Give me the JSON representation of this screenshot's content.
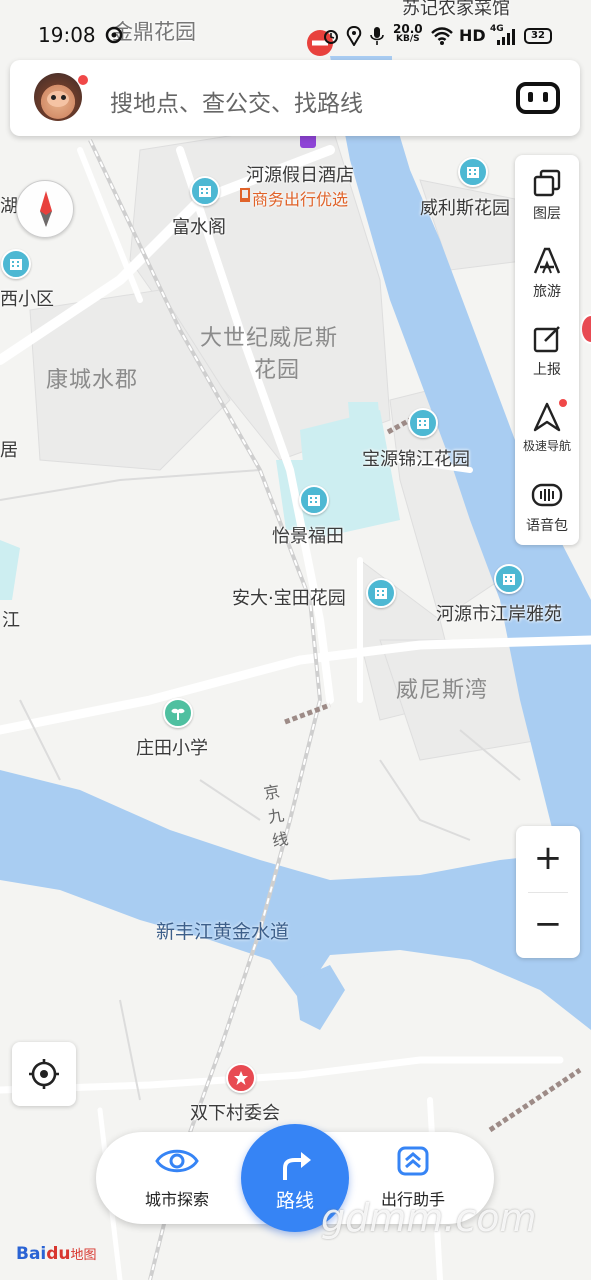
{
  "status_bar": {
    "time": "19:08",
    "net_speed_value": "20.0",
    "net_speed_unit": "KB/S",
    "hd": "HD",
    "signal": "4G",
    "battery": "32"
  },
  "search": {
    "placeholder": "搜地点、查公交、找路线"
  },
  "toolbar": {
    "items": [
      {
        "label": "图层",
        "icon": "layers-icon"
      },
      {
        "label": "旅游",
        "icon": "travel-icon"
      },
      {
        "label": "上报",
        "icon": "report-icon"
      },
      {
        "label": "极速导航",
        "icon": "navigation-icon"
      },
      {
        "label": "语音包",
        "icon": "voice-pack-icon"
      }
    ]
  },
  "zoom": {
    "in": "+",
    "out": "−"
  },
  "map": {
    "pois": [
      {
        "name": "金鼎花园"
      },
      {
        "name": "苏记农家菜馆"
      },
      {
        "name": "河源假日酒店"
      },
      {
        "name": "商务出行优选"
      },
      {
        "name": "富水阁"
      },
      {
        "name": "威利斯花园"
      },
      {
        "name": "西小区"
      },
      {
        "name": "湖"
      },
      {
        "name": "宝源锦江花园"
      },
      {
        "name": "怡景福田"
      },
      {
        "name": "安大·宝田花园"
      },
      {
        "name": "河源市江岸雅苑"
      },
      {
        "name": "庄田小学"
      },
      {
        "name": "双下村委会"
      },
      {
        "name": "江"
      },
      {
        "name": "居"
      }
    ],
    "areas": [
      "大世纪威尼斯",
      "花园",
      "康城水郡",
      "威尼斯湾"
    ],
    "road": "京九线",
    "water": "新丰江黄金水道"
  },
  "bottom_bar": {
    "explore": "城市探索",
    "route": "路线",
    "assistant": "出行助手"
  },
  "brand": {
    "logo": "Bai",
    "logo2": "du",
    "logo_suffix": "地图",
    "watermark": "gdmm.com"
  },
  "colors": {
    "water": "#a9cdf2",
    "accent": "#3684f5",
    "land": "#f4f4f2",
    "poi": "#4db8d3"
  }
}
